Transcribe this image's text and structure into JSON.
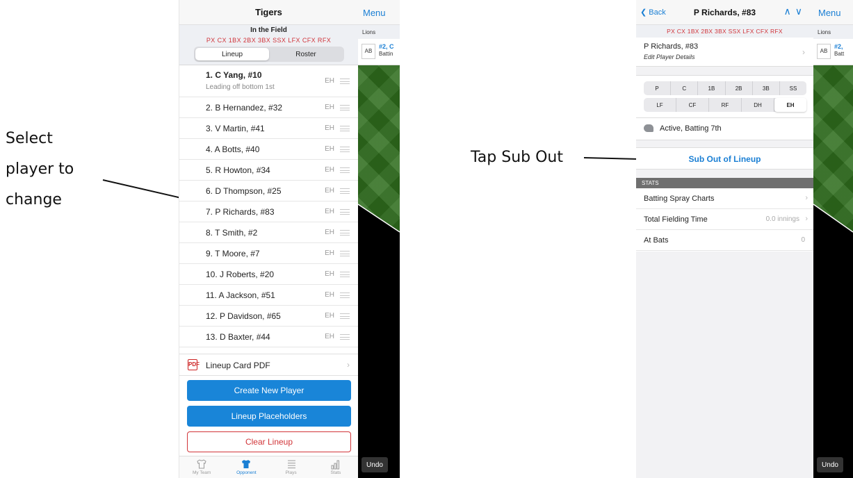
{
  "instructions": {
    "left_line1": "Select",
    "left_line2": "player to",
    "left_line3": "change",
    "right": "Tap Sub Out"
  },
  "left_panel": {
    "title": "Tigers",
    "field_title": "In the Field",
    "positions": "PX  CX  1BX  2BX  3BX  SSX  LFX  CFX  RFX",
    "tabs": [
      "Lineup",
      "Roster"
    ],
    "lineup": [
      {
        "name": "1. C Yang, #10",
        "sub": "Leading off bottom 1st",
        "pos": "EH"
      },
      {
        "name": "2. B Hernandez, #32",
        "pos": "EH"
      },
      {
        "name": "3. V Martin, #41",
        "pos": "EH"
      },
      {
        "name": "4. A Botts, #40",
        "pos": "EH"
      },
      {
        "name": "5. R Howton, #34",
        "pos": "EH"
      },
      {
        "name": "6. D Thompson, #25",
        "pos": "EH"
      },
      {
        "name": "7. P Richards, #83",
        "pos": "EH"
      },
      {
        "name": "8. T Smith, #2",
        "pos": "EH"
      },
      {
        "name": "9. T Moore, #7",
        "pos": "EH"
      },
      {
        "name": "10. J Roberts, #20",
        "pos": "EH"
      },
      {
        "name": "11. A Jackson, #51",
        "pos": "EH"
      },
      {
        "name": "12. P Davidson, #65",
        "pos": "EH"
      },
      {
        "name": "13. D Baxter, #44",
        "pos": "EH"
      }
    ],
    "pdf_label": "Lineup Card PDF",
    "pdf_icon": "PDF",
    "buttons": {
      "create": "Create New Player",
      "placeholders": "Lineup Placeholders",
      "clear": "Clear Lineup"
    },
    "tabbar": [
      {
        "label": "My Team",
        "icon": "jersey-outline-icon"
      },
      {
        "label": "Opponent",
        "icon": "jersey-filled-icon"
      },
      {
        "label": "Plays",
        "icon": "list-icon"
      },
      {
        "label": "Stats",
        "icon": "bar-chart-icon"
      }
    ]
  },
  "field_strip": {
    "menu": "Menu",
    "team": "Lions",
    "ab": "AB",
    "ab_num_left": "#2, C",
    "ab_sub_left": "Battin",
    "ab_num_right": "#2,",
    "ab_sub_right": "Batt",
    "undo": "Undo"
  },
  "right_panel": {
    "back": "Back",
    "title": "P Richards, #83",
    "positions": "PX  CX  1BX  2BX  3BX  SSX  LFX  CFX  RFX",
    "player_name": "P Richards, #83",
    "edit_details": "Edit Player Details",
    "pos_row1": [
      "P",
      "C",
      "1B",
      "2B",
      "3B",
      "SS"
    ],
    "pos_row2": [
      "LF",
      "CF",
      "RF",
      "DH",
      "EH"
    ],
    "selected_position": "EH",
    "status": "Active, Batting 7th",
    "sub_out": "Sub Out of Lineup",
    "stats_header": "STATS",
    "stats": [
      {
        "label": "Batting Spray Charts",
        "value": ""
      },
      {
        "label": "Total Fielding Time",
        "value": "0.0 innings"
      },
      {
        "label": "At Bats",
        "value": "0"
      }
    ]
  },
  "colors": {
    "accent": "#1a7fd4",
    "button_blue": "#1985d8",
    "danger": "#d13438",
    "grass": "#2f6d1d"
  }
}
